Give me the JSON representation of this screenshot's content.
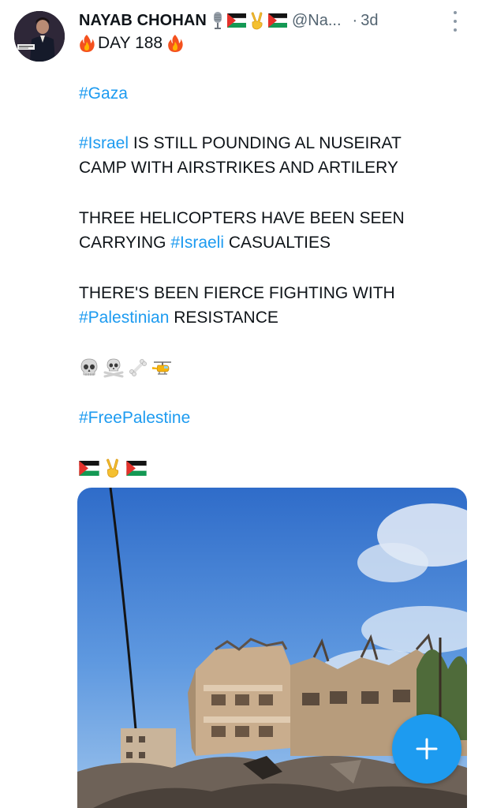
{
  "tweet": {
    "author": {
      "display_name": "NAYAB CHOHAN",
      "handle": "@Na...",
      "name_emojis": [
        "microphone-icon",
        "palestine-flag-icon",
        "victory-hand-icon",
        "palestine-flag-icon"
      ]
    },
    "separator": "·",
    "time": "3d",
    "day_line": {
      "prefix_icon": "fire-icon",
      "text": "DAY 188",
      "suffix_icon": "fire-icon"
    },
    "hashtag_gaza": "#Gaza",
    "para1": {
      "hashtag": "#Israel",
      "line1_rest": " IS STILL POUNDING AL NUSEIRAT",
      "line2": "CAMP WITH AIRSTRIKES AND ARTILERY"
    },
    "para2": {
      "line1": "THREE HELICOPTERS HAVE BEEN SEEN",
      "line2_prefix": "CARRYING ",
      "hashtag": "#Israeli",
      "line2_suffix": " CASUALTIES"
    },
    "para3": {
      "line1": "THERE'S BEEN FIERCE FIGHTING WITH",
      "hashtag": "#Palestinian",
      "line2_suffix": " RESISTANCE"
    },
    "emoji_row1": [
      "skull-icon",
      "skull-crossbones-icon",
      "bone-icon",
      "helicopter-icon"
    ],
    "hashtag_free": "#FreePalestine",
    "emoji_row2": [
      "palestine-flag-icon",
      "victory-hand-icon",
      "palestine-flag-icon"
    ],
    "media": {
      "kind": "video-thumbnail"
    }
  },
  "fab": {
    "icon": "plus-icon"
  },
  "colors": {
    "link": "#1d9bf0",
    "text": "#0f1419",
    "secondary": "#536471",
    "fab": "#1d9bf0"
  }
}
